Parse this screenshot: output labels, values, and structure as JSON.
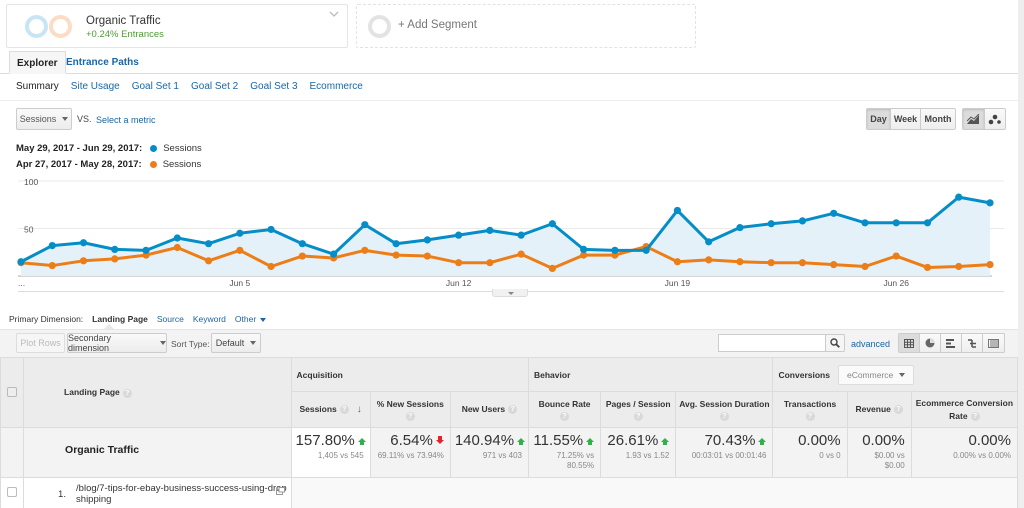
{
  "segments": {
    "active": {
      "title": "Organic Traffic",
      "subtitle": "+0.24% Entrances"
    },
    "add_label": "+ Add Segment"
  },
  "tabs": [
    {
      "label": "Explorer",
      "active": true
    },
    {
      "label": "Entrance Paths",
      "active": false
    }
  ],
  "subtabs": [
    {
      "label": "Summary",
      "active": true
    },
    {
      "label": "Site Usage",
      "active": false
    },
    {
      "label": "Goal Set 1",
      "active": false
    },
    {
      "label": "Goal Set 2",
      "active": false
    },
    {
      "label": "Goal Set 3",
      "active": false
    },
    {
      "label": "Ecommerce",
      "active": false
    }
  ],
  "metric": {
    "selected": "Sessions",
    "vs_label": "VS.",
    "select_metric": "Select a metric"
  },
  "granularity": {
    "options": [
      "Day",
      "Week",
      "Month"
    ],
    "selected": "Day"
  },
  "chart_type_buttons": [
    "line-chart-icon",
    "motion-chart-icon"
  ],
  "legend": [
    {
      "range": "May 29, 2017 - Jun 29, 2017:",
      "metric": "Sessions",
      "color": "#058dc7"
    },
    {
      "range": "Apr 27, 2017 - May 28, 2017:",
      "metric": "Sessions",
      "color": "#ed7e17"
    }
  ],
  "chart_data": {
    "type": "line",
    "title": "",
    "xlabel": "",
    "ylabel": "Sessions",
    "ylim": [
      0,
      100
    ],
    "yticks": [
      50,
      100
    ],
    "grid": true,
    "x_tick_labels": [
      {
        "index": 0,
        "label": "..."
      },
      {
        "index": 7,
        "label": "Jun 5"
      },
      {
        "index": 14,
        "label": "Jun 12"
      },
      {
        "index": 21,
        "label": "Jun 19"
      },
      {
        "index": 28,
        "label": "Jun 26"
      }
    ],
    "x": [
      "May 29",
      "May 30",
      "May 31",
      "Jun 1",
      "Jun 2",
      "Jun 3",
      "Jun 4",
      "Jun 5",
      "Jun 6",
      "Jun 7",
      "Jun 8",
      "Jun 9",
      "Jun 10",
      "Jun 11",
      "Jun 12",
      "Jun 13",
      "Jun 14",
      "Jun 15",
      "Jun 16",
      "Jun 17",
      "Jun 18",
      "Jun 19",
      "Jun 20",
      "Jun 21",
      "Jun 22",
      "Jun 23",
      "Jun 24",
      "Jun 25",
      "Jun 26",
      "Jun 27",
      "Jun 28",
      "Jun 29"
    ],
    "series": [
      {
        "name": "Sessions (May 29, 2017 - Jun 29, 2017)",
        "color": "#058dc7",
        "fill": true,
        "values": [
          15,
          32,
          35,
          28,
          27,
          40,
          34,
          45,
          49,
          34,
          23,
          54,
          34,
          38,
          43,
          48,
          43,
          55,
          28,
          27,
          27,
          69,
          36,
          51,
          55,
          58,
          66,
          56,
          56,
          56,
          83,
          77
        ]
      },
      {
        "name": "Sessions (Apr 27, 2017 - May 28, 2017)",
        "color": "#ed7e17",
        "fill": false,
        "values": [
          14,
          11,
          16,
          18,
          22,
          30,
          16,
          27,
          10,
          21,
          19,
          27,
          22,
          21,
          14,
          14,
          23,
          8,
          22,
          22,
          31,
          15,
          17,
          15,
          14,
          14,
          12,
          10,
          21,
          9,
          10,
          12
        ]
      }
    ]
  },
  "dimension": {
    "label": "Primary Dimension:",
    "options": [
      "Landing Page",
      "Source",
      "Keyword",
      "Other"
    ],
    "selected": "Landing Page"
  },
  "table_toolbar": {
    "plot_rows": "Plot Rows",
    "secondary_dimension": "Secondary dimension",
    "sort_type_label": "Sort Type:",
    "sort_type_value": "Default",
    "search_value": "",
    "advanced": "advanced",
    "view_icons": [
      "data-table-icon",
      "pie-chart-icon",
      "performance-bar-icon",
      "comparison-icon",
      "pivot-icon"
    ]
  },
  "table": {
    "dimension_header": "Landing Page",
    "groups": [
      {
        "label": "Acquisition"
      },
      {
        "label": "Behavior"
      },
      {
        "label": "Conversions",
        "select": "eCommerce"
      }
    ],
    "columns": [
      "Sessions",
      "% New Sessions",
      "New Users",
      "Bounce Rate",
      "Pages / Session",
      "Avg. Session Duration",
      "Transactions",
      "Revenue",
      "Ecommerce Conversion Rate"
    ],
    "summary": {
      "label": "Organic Traffic",
      "cells": [
        {
          "value": "157.80%",
          "trend": "up",
          "detail": "1,405 vs 545"
        },
        {
          "value": "6.54%",
          "trend": "down",
          "detail": "69.11% vs 73.94%"
        },
        {
          "value": "140.94%",
          "trend": "up",
          "detail": "971 vs 403"
        },
        {
          "value": "11.55%",
          "trend": "up",
          "detail": "71.25% vs 80.55%"
        },
        {
          "value": "26.61%",
          "trend": "up",
          "detail": "1.93 vs 1.52"
        },
        {
          "value": "70.43%",
          "trend": "up",
          "detail": "00:03:01 vs 00:01:46"
        },
        {
          "value": "0.00%",
          "trend": "none",
          "detail": "0 vs 0"
        },
        {
          "value": "0.00%",
          "trend": "none",
          "detail": "$0.00 vs $0.00"
        },
        {
          "value": "0.00%",
          "trend": "none",
          "detail": "0.00% vs 0.00%"
        }
      ]
    },
    "rows": [
      {
        "index": "1.",
        "page": "/blog/7-tips-for-ebay-business-success-using-dropshipping"
      }
    ]
  },
  "colors": {
    "accent_link": "#1a66a6",
    "up": "#2fb24a",
    "down": "#e0242f",
    "series1": "#058dc7",
    "series2": "#ed7e17"
  }
}
